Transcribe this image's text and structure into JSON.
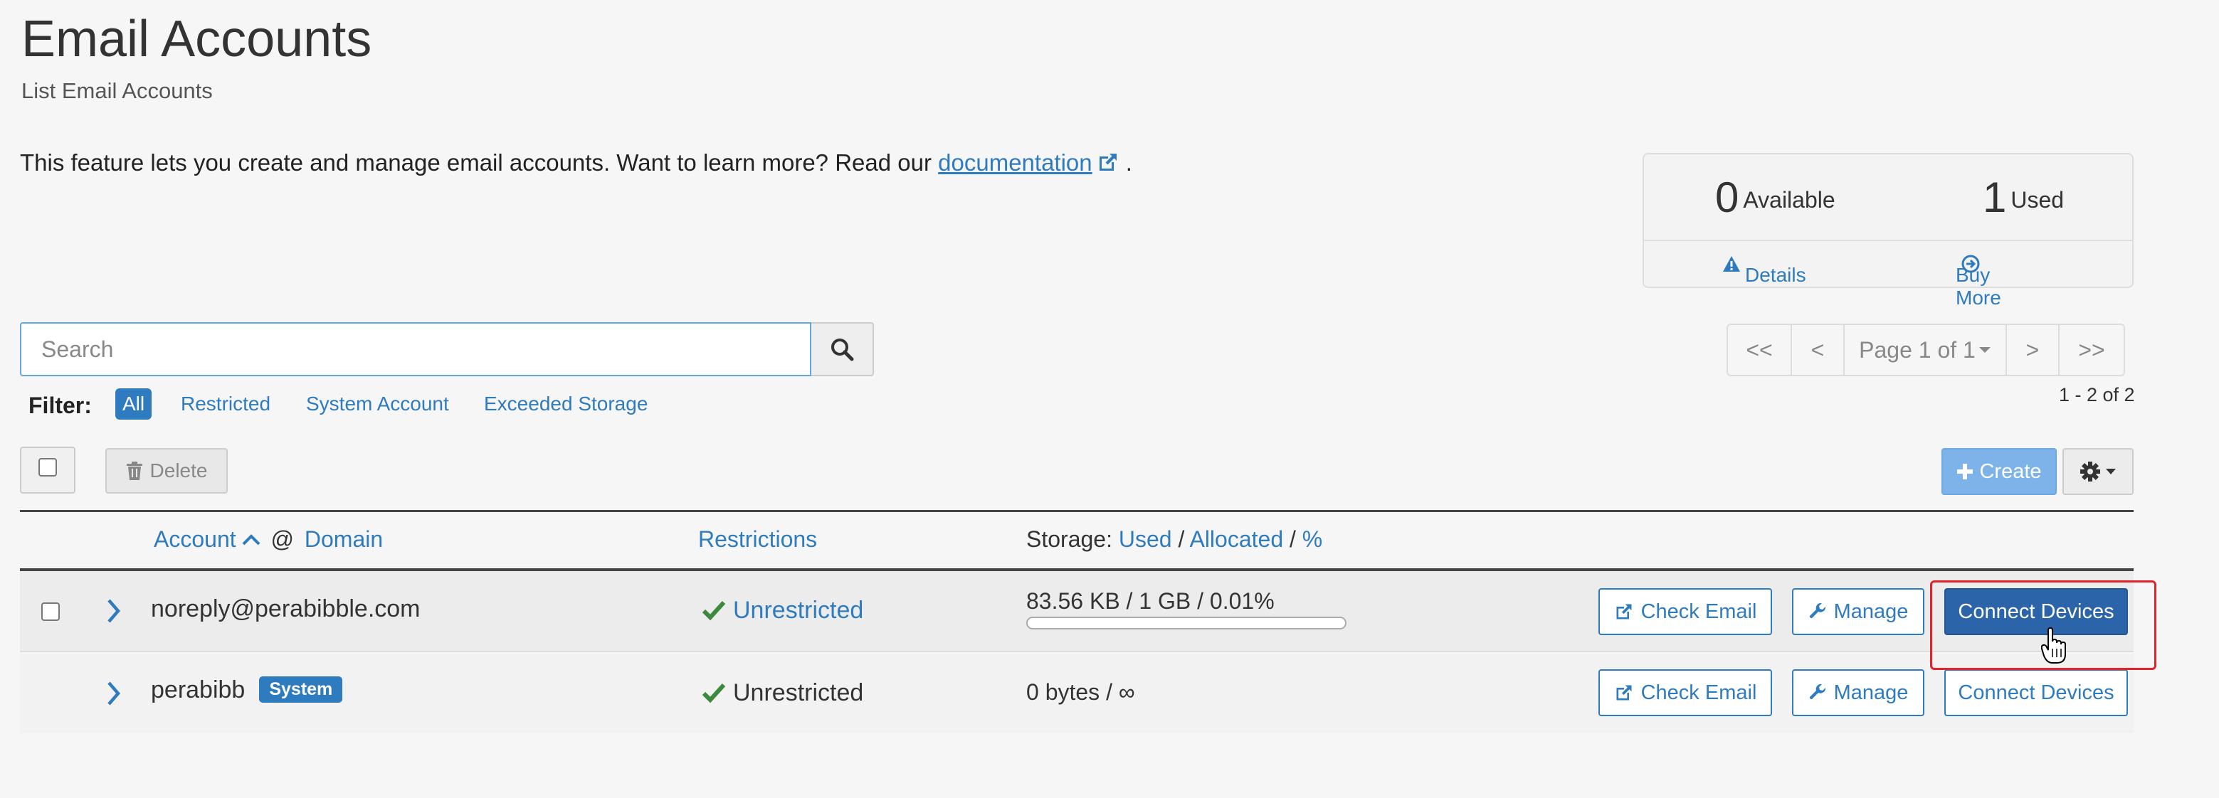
{
  "header": {
    "title": "Email Accounts",
    "subtitle": "List Email Accounts"
  },
  "description": {
    "text_before": "This feature lets you create and manage email accounts. Want to learn more? Read our ",
    "link_text": "documentation",
    "text_after": "."
  },
  "stats": {
    "available_count": "0",
    "available_label": "Available",
    "used_count": "1",
    "used_label": "Used",
    "details_link": "Details",
    "buy_more_link": "Buy More"
  },
  "search": {
    "placeholder": "Search"
  },
  "pagination": {
    "first": "<<",
    "prev": "<",
    "page_label": "Page 1 of 1",
    "next": ">",
    "last": ">>",
    "range": "1 - 2 of 2"
  },
  "filter": {
    "label": "Filter:",
    "options": [
      "All",
      "Restricted",
      "System Account",
      "Exceeded Storage"
    ],
    "active": "All"
  },
  "toolbar": {
    "delete_label": "Delete",
    "create_label": "Create"
  },
  "table": {
    "headers": {
      "account": "Account",
      "at": "@",
      "domain": "Domain",
      "restrictions": "Restrictions",
      "storage_prefix": "Storage:",
      "used": "Used",
      "slash1": "/",
      "allocated": "Allocated",
      "slash2": "/",
      "percent": "%"
    },
    "rows": [
      {
        "account": "noreply@perabibble.com",
        "badge": "",
        "restriction": "Unrestricted",
        "storage": "83.56 KB / 1 GB / 0.01%",
        "usage_percent": 0.01,
        "check_email": "Check Email",
        "manage": "Manage",
        "connect": "Connect Devices"
      },
      {
        "account": "perabibb",
        "badge": "System",
        "restriction": "Unrestricted",
        "storage": "0 bytes / ∞",
        "check_email": "Check Email",
        "manage": "Manage",
        "connect": "Connect Devices"
      }
    ]
  },
  "colors": {
    "accent": "#2f7bbf",
    "primary_button": "#2b64a8",
    "create_button": "#7db3e8",
    "success": "#3c8a3c",
    "highlight": "#e2232a"
  }
}
